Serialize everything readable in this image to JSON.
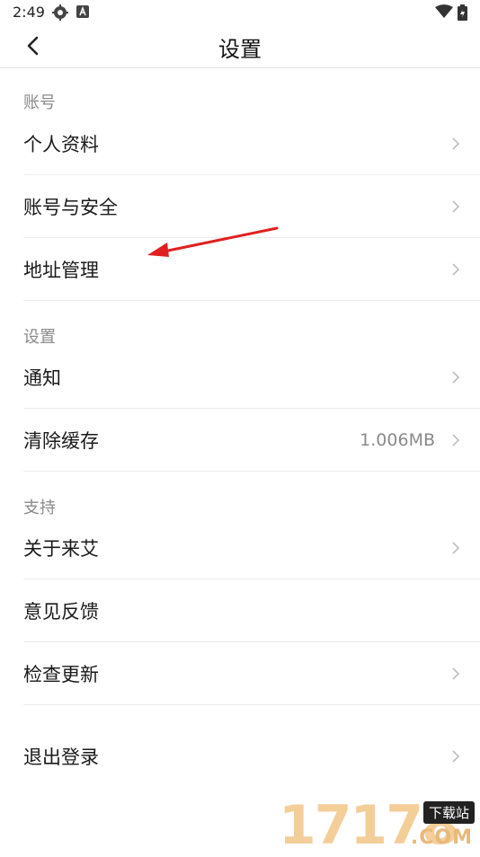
{
  "status_bar": {
    "time": "2:49",
    "icons": [
      "settings-gear-icon",
      "notification-a-icon",
      "wifi-icon",
      "battery-charging-icon"
    ]
  },
  "nav": {
    "title": "设置",
    "back_icon": "chevron-left-icon"
  },
  "sections": [
    {
      "header": "账号",
      "items": [
        {
          "label": "个人资料",
          "value": ""
        },
        {
          "label": "账号与安全",
          "value": ""
        },
        {
          "label": "地址管理",
          "value": ""
        }
      ]
    },
    {
      "header": "设置",
      "items": [
        {
          "label": "通知",
          "value": ""
        },
        {
          "label": "清除缓存",
          "value": "1.006MB"
        }
      ]
    },
    {
      "header": "支持",
      "items": [
        {
          "label": "关于来艾",
          "value": ""
        },
        {
          "label": "意见反馈",
          "value": ""
        },
        {
          "label": "检查更新",
          "value": ""
        }
      ]
    }
  ],
  "logout": {
    "label": "退出登录"
  },
  "annotation": {
    "arrow_color": "#e02020"
  },
  "watermark": {
    "digits": "17178",
    "badge": "下载站",
    "suffix": ".COM"
  },
  "colors": {
    "text": "#1a1a1a",
    "muted": "#8a8a8a",
    "divider": "#ececec",
    "background": "#ffffff"
  }
}
